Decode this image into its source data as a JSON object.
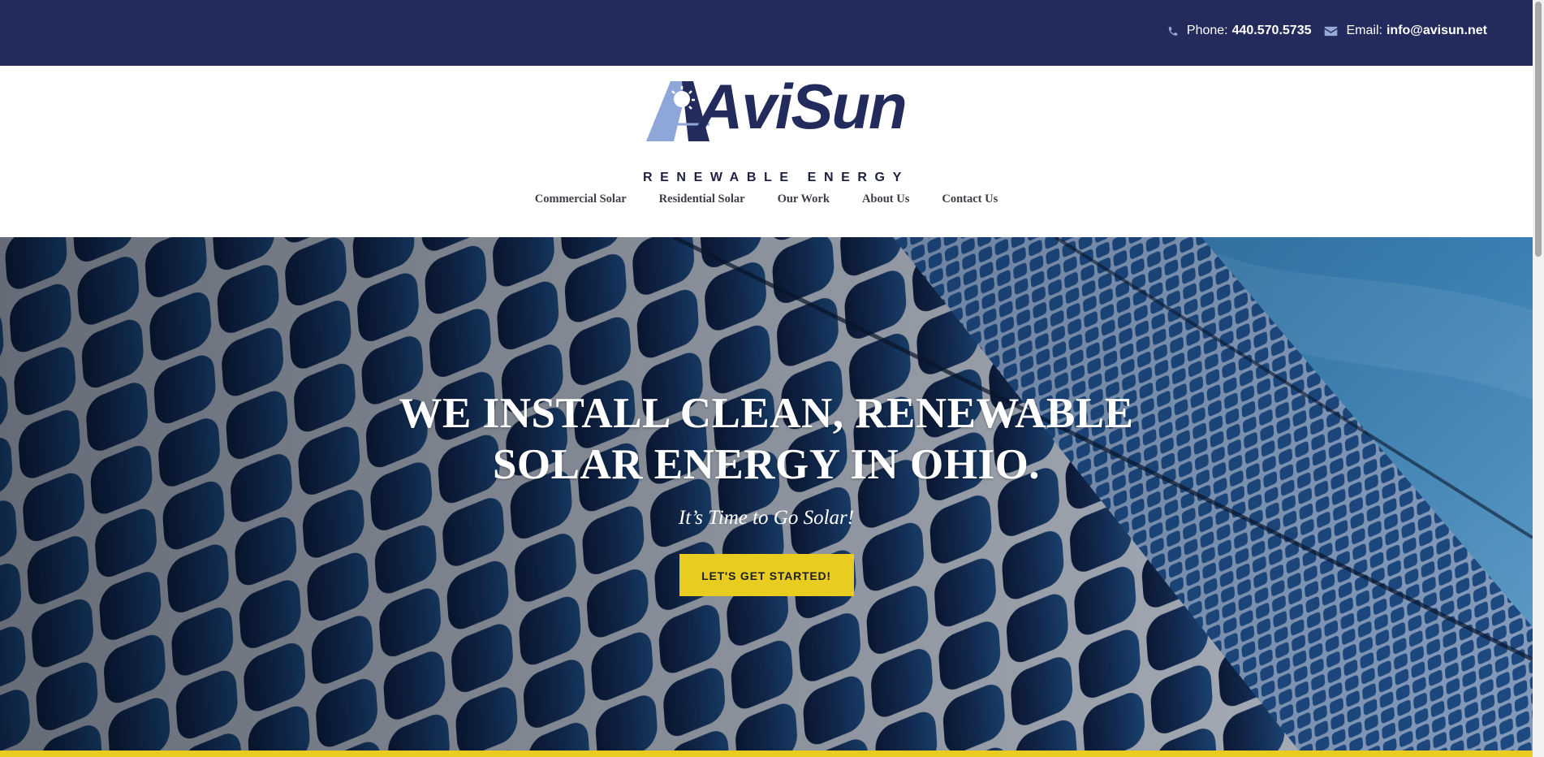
{
  "topbar": {
    "phone_label": "Phone:",
    "phone_value": "440.570.5735",
    "email_label": "Email:",
    "email_value": "info@avisun.net",
    "phone_icon": "phone-icon",
    "email_icon": "envelope-icon"
  },
  "logo": {
    "wordmark": "AviSun",
    "tagline": "RENEWABLE ENERGY"
  },
  "nav": {
    "items": [
      "Commercial Solar",
      "Residential Solar",
      "Our Work",
      "About Us",
      "Contact Us"
    ]
  },
  "hero": {
    "title_line1": "WE INSTALL CLEAN, RENEWABLE",
    "title_line2": "SOLAR ENERGY IN OHIO.",
    "subtitle": "It’s Time to Go Solar!",
    "cta_label": "LET'S GET STARTED!",
    "background": "solar-panels-photo"
  },
  "colors": {
    "navy": "#222b5c",
    "accent_yellow": "#e8cd20",
    "logo_light_blue": "#8ea7d8",
    "nav_text": "#3e3e46"
  }
}
